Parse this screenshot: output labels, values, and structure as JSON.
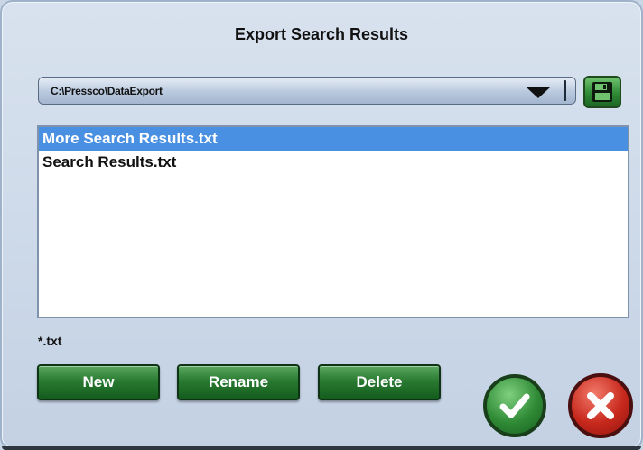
{
  "dialog": {
    "title": "Export Search Results"
  },
  "path_selector": {
    "value": "C:\\Pressco\\DataExport",
    "arrow_icon": "triangle-down-icon"
  },
  "save_button": {
    "icon": "floppy-disk-icon"
  },
  "file_list": {
    "items": [
      {
        "label": "More Search Results.txt",
        "selected": true
      },
      {
        "label": "Search Results.txt",
        "selected": false
      }
    ],
    "selected_color": "#4a90e2"
  },
  "filter": {
    "label": "*.txt"
  },
  "actions": {
    "new_label": "New",
    "rename_label": "Rename",
    "delete_label": "Delete"
  },
  "dialog_buttons": {
    "ok_icon": "checkmark-icon",
    "cancel_icon": "x-close-icon",
    "ok_color": "#2f8a35",
    "cancel_color": "#c7281c"
  }
}
